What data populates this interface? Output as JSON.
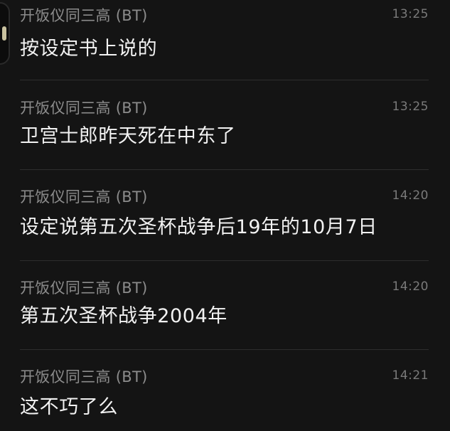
{
  "messages": [
    {
      "sender": "开饭仪同三高 (BT)",
      "time": "13:25",
      "text": "按设定书上说的"
    },
    {
      "sender": "开饭仪同三高 (BT)",
      "time": "13:25",
      "text": "卫宫士郎昨天死在中东了"
    },
    {
      "sender": "开饭仪同三高 (BT)",
      "time": "14:20",
      "text": "设定说第五次圣杯战争后19年的10月7日"
    },
    {
      "sender": "开饭仪同三高 (BT)",
      "time": "14:20",
      "text": "第五次圣杯战争2004年"
    },
    {
      "sender": "开饭仪同三高 (BT)",
      "time": "14:21",
      "text": "这不巧了么"
    }
  ]
}
